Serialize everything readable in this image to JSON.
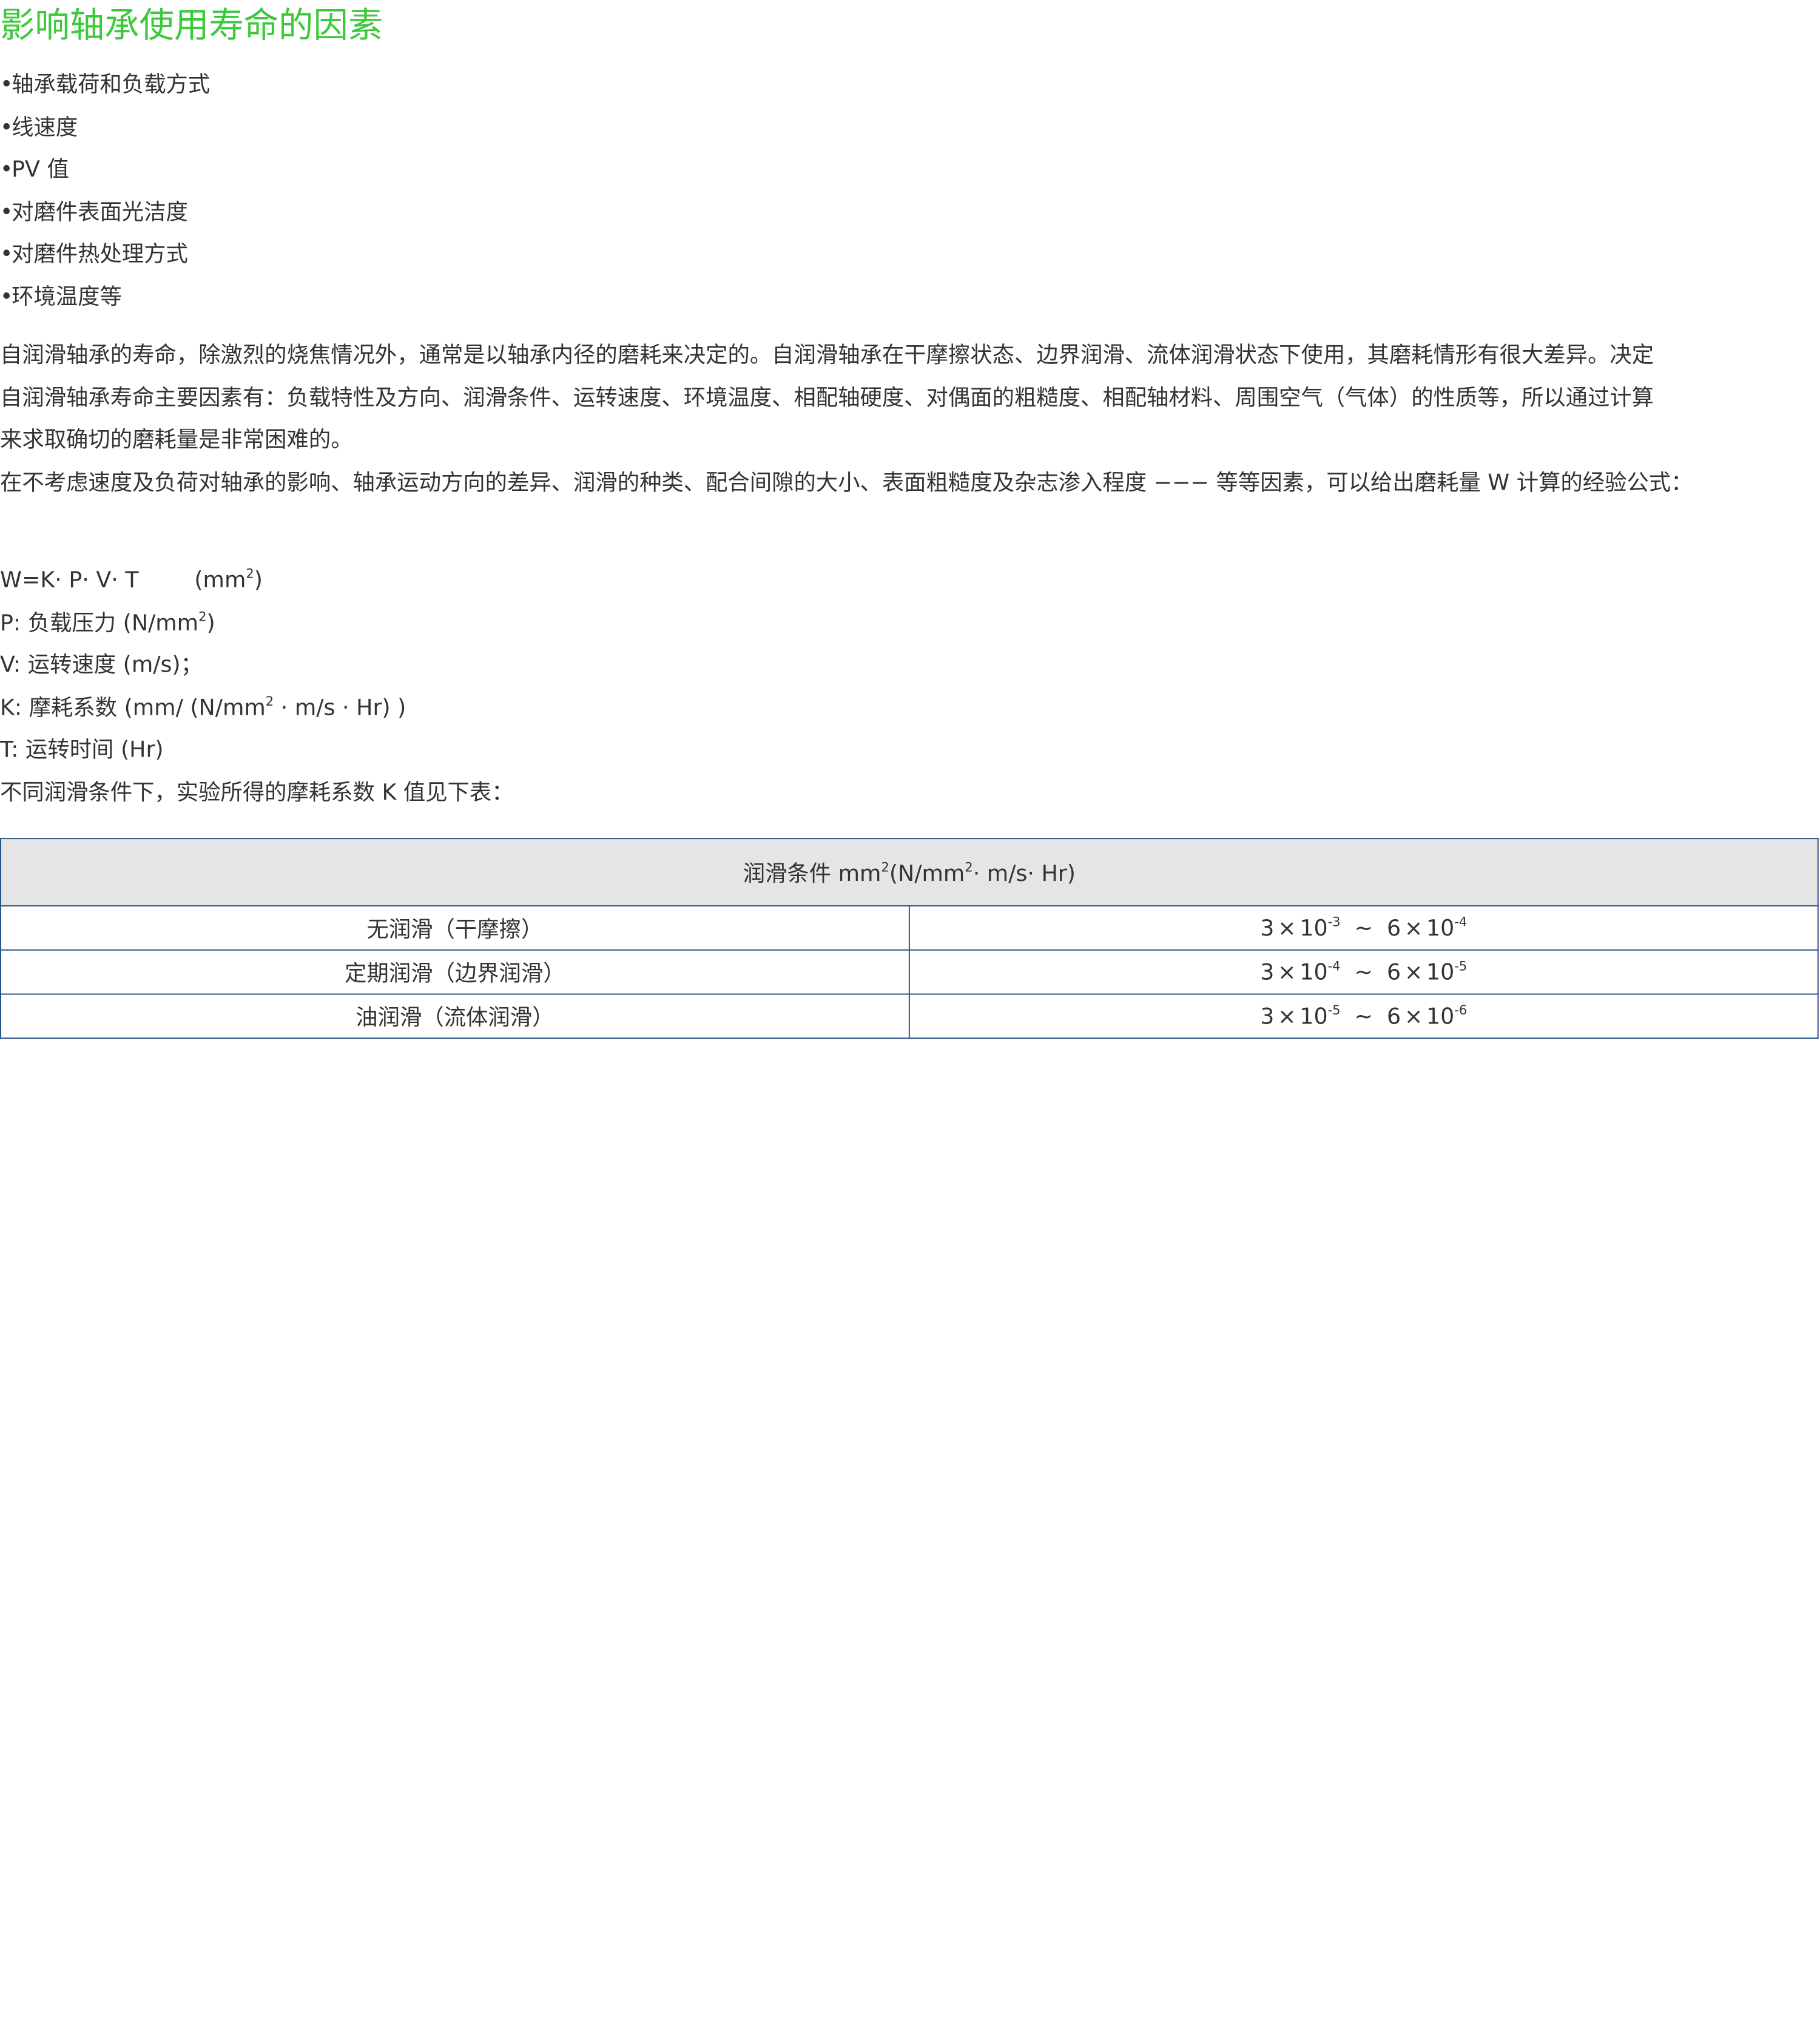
{
  "theme": {
    "title_color": "#3cc93c",
    "text_color": "#333333",
    "table_header_bg": "#e5e5e5",
    "table_border_color": "#1f4e82"
  },
  "title": "影响轴承使用寿命的因素",
  "bullet_symbol": "•",
  "factors": [
    "轴承载荷和负载方式",
    "线速度",
    "PV 值",
    "对磨件表面光洁度",
    "对磨件热处理方式",
    "环境温度等"
  ],
  "paragraphs": {
    "p1_line1": "自润滑轴承的寿命，除激烈的烧焦情况外，通常是以轴承内径的磨耗来决定的。自润滑轴承在干摩擦状态、边界润滑、流体润滑状态下使用，其磨耗情形有很大差异。决定",
    "p1_line2": "自润滑轴承寿命主要因素有：负载特性及方向、润滑条件、运转速度、环境温度、相配轴硬度、对偶面的粗糙度、相配轴材料、周围空气（气体）的性质等，所以通过计算",
    "p1_line3": "来求取确切的磨耗量是非常困难的。",
    "p2": "在不考虑速度及负荷对轴承的影响、轴承运动方向的差异、润滑的种类、配合间隙的大小、表面粗糙度及杂志渗入程度 −−− 等等因素，可以给出磨耗量 W 计算的经验公式："
  },
  "formula": {
    "main": "W=K· P· V· T",
    "main_unit_pre": "(mm",
    "main_unit_sup": "2",
    "main_unit_post": ")",
    "p_pre": "P: 负载压力 (N/mm",
    "p_sup": "2",
    "p_post": ")",
    "v": "V: 运转速度 (m/s)；",
    "k_pre": "K: 摩耗系数 (mm/ (N/mm",
    "k_sup": "2",
    "k_post": " · m/s · Hr) )",
    "t": "T: 运转时间 (Hr)",
    "table_intro": "不同润滑条件下，实验所得的摩耗系数 K 值见下表："
  },
  "table": {
    "header_pre": "润滑条件 mm",
    "header_sup1": "2",
    "header_mid": "(N/mm",
    "header_sup2": "2",
    "header_post": "· m/s· Hr)",
    "rows": [
      {
        "condition": "无润滑（干摩擦）",
        "low_coef": "3",
        "low_exp": "-3",
        "high_coef": "6",
        "high_exp": "-4"
      },
      {
        "condition": "定期润滑（边界润滑）",
        "low_coef": "3",
        "low_exp": "-4",
        "high_coef": "6",
        "high_exp": "-5"
      },
      {
        "condition": "油润滑（流体润滑）",
        "low_coef": "3",
        "low_exp": "-5",
        "high_coef": "6",
        "high_exp": "-6"
      }
    ],
    "times": "×",
    "ten": "10",
    "tilde": "~"
  }
}
